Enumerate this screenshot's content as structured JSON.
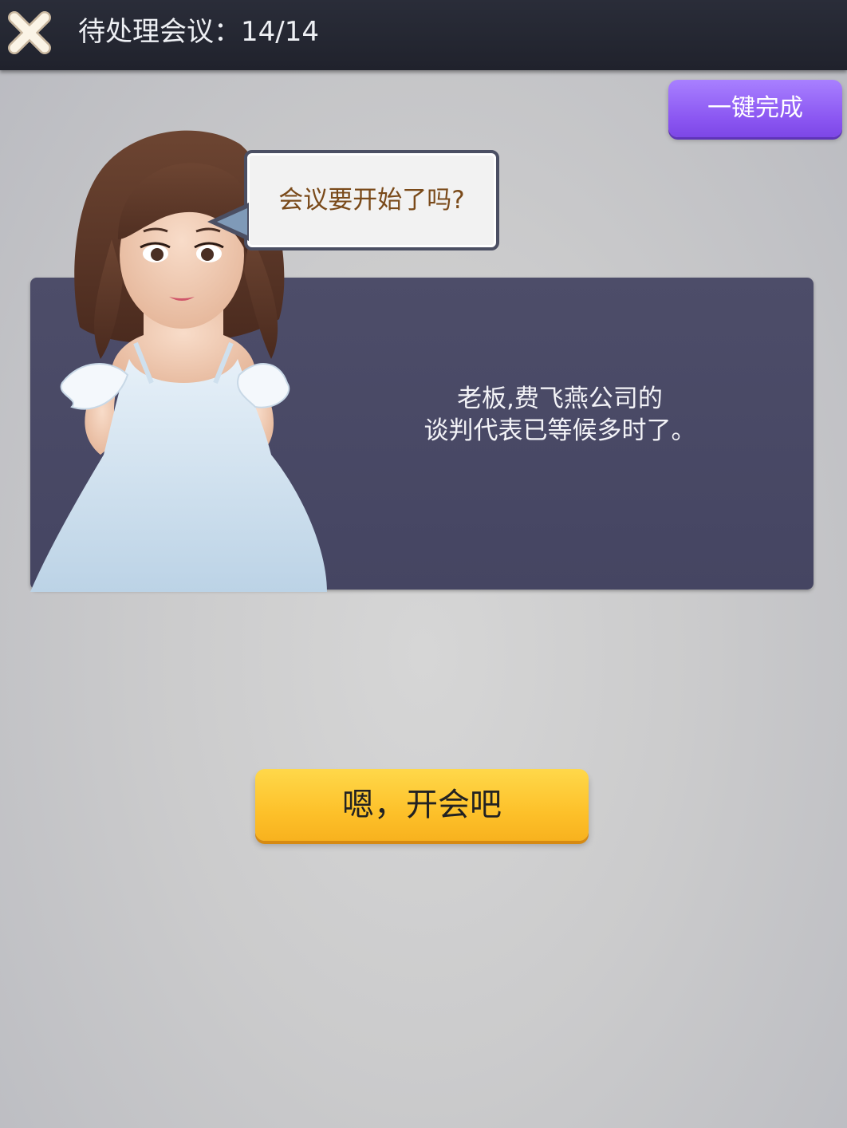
{
  "header": {
    "title": "待处理会议：14/14",
    "close_icon": "close-icon"
  },
  "quick_complete": {
    "label": "一键完成"
  },
  "speech_bubble": {
    "text": "会议要开始了吗?"
  },
  "dialogue": {
    "lines": [
      "老板,费飞燕公司的",
      "谈判代表已等候多时了。"
    ]
  },
  "action": {
    "label": "嗯，开会吧"
  },
  "colors": {
    "topbar": "#22242e",
    "quick_button": "#8a55f1",
    "panel": "#4a4a66",
    "action_button": "#fdc12a",
    "bubble_text": "#7a4a1a"
  }
}
